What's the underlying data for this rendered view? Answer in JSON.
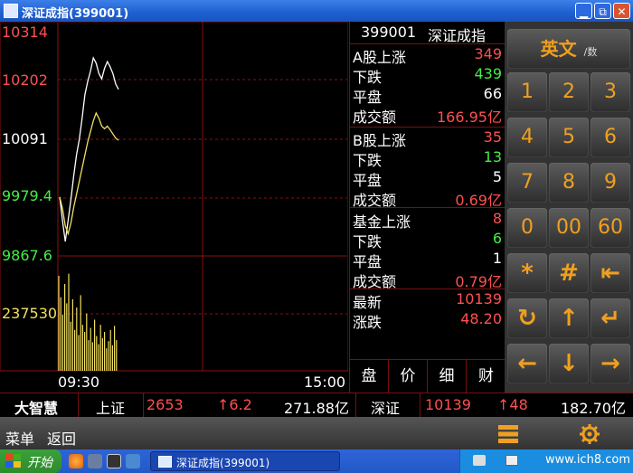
{
  "window": {
    "title": "深证成指(399001)",
    "min_glyph": "▁",
    "max_glyph": "⧉",
    "close_glyph": "✕"
  },
  "chart": {
    "y_labels": [
      {
        "text": "10314",
        "color": "#ff5050"
      },
      {
        "text": "10202",
        "color": "#ff5050"
      },
      {
        "text": "10091",
        "color": "#ffffff"
      },
      {
        "text": "9979.4",
        "color": "#44ee44"
      },
      {
        "text": "9867.6",
        "color": "#44ee44"
      },
      {
        "text": "237530",
        "color": "#f0e060"
      }
    ],
    "x_start": "09:30",
    "x_end": "15:00"
  },
  "chart_data": {
    "type": "line",
    "ylim": [
      9867.6,
      10314
    ],
    "base": 10091,
    "series": [
      {
        "values": [
          9980,
          9935,
          9895,
          9935,
          9975,
          10020,
          10060,
          10090,
          10130,
          10175,
          10200,
          10220,
          10245,
          10235,
          10215,
          10205,
          10225,
          10238,
          10228,
          10215,
          10195,
          10185
        ]
      },
      {
        "values": [
          9980,
          9958,
          9925,
          9910,
          9930,
          9960,
          9985,
          10010,
          10035,
          10060,
          10085,
          10105,
          10125,
          10140,
          10130,
          10115,
          10110,
          10115,
          10108,
          10100,
          10092,
          10088
        ]
      }
    ],
    "volume": {
      "max": 237530,
      "values": [
        0.93,
        0.72,
        0.55,
        0.85,
        0.66,
        0.95,
        0.48,
        0.7,
        0.4,
        0.62,
        0.35,
        0.74,
        0.45,
        0.38,
        0.56,
        0.3,
        0.42,
        0.28,
        0.5,
        0.34,
        0.26,
        0.45,
        0.32,
        0.38,
        0.22,
        0.29,
        0.4,
        0.25,
        0.44,
        0.3
      ]
    }
  },
  "stats": {
    "code": "399001",
    "name": "深证成指",
    "rows": [
      {
        "k": "A股上涨",
        "v": "349",
        "color": "#ff5050"
      },
      {
        "k": "下跌",
        "v": "439",
        "color": "#44ee44"
      },
      {
        "k": "平盘",
        "v": "66",
        "color": "#ffffff"
      },
      {
        "k": "成交额",
        "v": "166.95亿",
        "color": "#ff5050"
      },
      {
        "k": "B股上涨",
        "v": "35",
        "color": "#ff5050"
      },
      {
        "k": "下跌",
        "v": "13",
        "color": "#44ee44"
      },
      {
        "k": "平盘",
        "v": "5",
        "color": "#ffffff"
      },
      {
        "k": "成交额",
        "v": "0.69亿",
        "color": "#ff5050"
      },
      {
        "k": "基金上涨",
        "v": "8",
        "color": "#ff5050"
      },
      {
        "k": "下跌",
        "v": "6",
        "color": "#44ee44"
      },
      {
        "k": "平盘",
        "v": "1",
        "color": "#ffffff"
      },
      {
        "k": "成交额",
        "v": "0.79亿",
        "color": "#ff5050"
      },
      {
        "k": "最新",
        "v": "10139",
        "color": "#ff5050"
      },
      {
        "k": "涨跌",
        "v": "48.20",
        "color": "#ff5050"
      }
    ],
    "tabs": [
      "盘",
      "价",
      "细",
      "财"
    ]
  },
  "keypad": {
    "lang_main": "英文",
    "lang_sub": "/数",
    "keys": [
      "1",
      "2",
      "3",
      "4",
      "5",
      "6",
      "7",
      "8",
      "9",
      "0",
      "00",
      "60",
      "*",
      "#",
      "⇤",
      "↻",
      "↑",
      "↵",
      "←",
      "↓",
      "→"
    ]
  },
  "quote": {
    "brand": "大智慧",
    "sh_name": "上证",
    "sh_value": "2653",
    "sh_change": "↑6.2",
    "sh_amount": "271.88亿",
    "sz_name": "深证",
    "sz_value": "10139",
    "sz_change": "↑48",
    "sz_amount": "182.70亿"
  },
  "menubar": {
    "menu": "菜单",
    "back": "返回"
  },
  "taskbar": {
    "start": "开始",
    "task_title": "深证成指(399001)",
    "url": "www.ich8.com"
  },
  "colors": {
    "up": "#ff5050",
    "down": "#44ee44",
    "grid": "#8a1010",
    "keypad": "#f0a020"
  }
}
